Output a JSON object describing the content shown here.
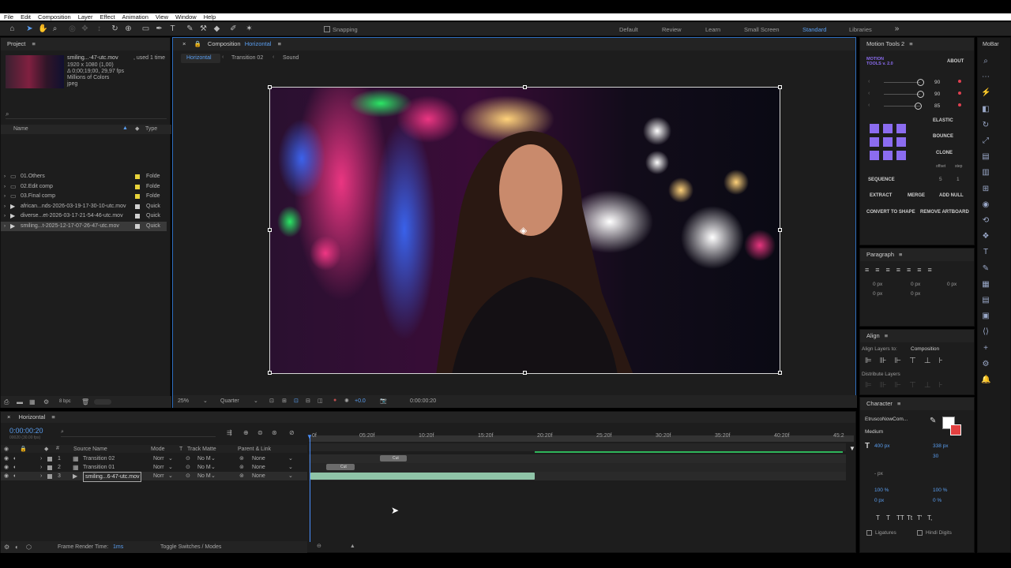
{
  "menu": [
    "File",
    "Edit",
    "Composition",
    "Layer",
    "Effect",
    "Animation",
    "View",
    "Window",
    "Help"
  ],
  "toolbar": {
    "snapping": "Snapping",
    "workspaces": [
      "Default",
      "Review",
      "Learn",
      "Small Screen",
      "Standard",
      "Libraries"
    ],
    "active_workspace": "Standard"
  },
  "project": {
    "title": "Project",
    "asset_name": "smiling...-47-utc.mov",
    "asset_used": ", used 1 time",
    "asset_info": [
      "1920 x 1080 (1,00)",
      "Δ 0;00;19;00, 29,97 fps",
      "Millions of Colors",
      "jpeg"
    ],
    "col_name": "Name",
    "col_type": "Type",
    "items": [
      {
        "name": "01.Others",
        "type": "Folde",
        "color": "#e8d33a",
        "kind": "folder"
      },
      {
        "name": "02.Edit comp",
        "type": "Folde",
        "color": "#e8d33a",
        "kind": "folder"
      },
      {
        "name": "03.Final comp",
        "type": "Folde",
        "color": "#e8d33a",
        "kind": "folder"
      },
      {
        "name": "african...nds-2026-03-19-17-30-10-utc.mov",
        "type": "Quick",
        "color": "#d0d0d0",
        "kind": "file"
      },
      {
        "name": "diverse...et-2026-03-17-21-54-46-utc.mov",
        "type": "Quick",
        "color": "#d0d0d0",
        "kind": "file"
      },
      {
        "name": "smiling...t-2025-12-17-07-26-47-utc.mov",
        "type": "Quick",
        "color": "#d0d0d0",
        "kind": "file"
      }
    ],
    "bpc": "8 bpc"
  },
  "composition": {
    "title": "Composition",
    "name": "Horizontal",
    "breadcrumbs": [
      "Horizontal",
      "Transition 02",
      "Sound"
    ],
    "zoom": "25%",
    "resolution": "Quarter",
    "exposure": "+0.0",
    "timecode": "0:00:00:20"
  },
  "timeline": {
    "tab": "Horizontal",
    "timecode": "0:00:00:20",
    "fps": "00020 (30.00 fps)",
    "headers": {
      "source": "Source Name",
      "mode": "Mode",
      "t": "T",
      "trackmatte": "Track Matte",
      "parent": "Parent & Link"
    },
    "ruler": [
      "0f",
      "05:20f",
      "10:20f",
      "15:20f",
      "20:20f",
      "25:20f",
      "30:20f",
      "35:20f",
      "40:20f",
      "45:2"
    ],
    "layers": [
      {
        "num": "1",
        "name": "Transition 02",
        "mode": "Norr",
        "matte": "No M",
        "parent": "None"
      },
      {
        "num": "2",
        "name": "Transition 01",
        "mode": "Norr",
        "matte": "No M",
        "parent": "None"
      },
      {
        "num": "3",
        "name": "smiling...6-47-utc.mov",
        "mode": "Norr",
        "matte": "No M",
        "parent": "None"
      }
    ],
    "clip_label": "Cut",
    "frame_render_label": "Frame Render Time:",
    "frame_render_value": "1ms",
    "toggle": "Toggle Switches / Modes"
  },
  "motion_tools": {
    "title": "Motion Tools 2",
    "brand": "MOTION TOOLS v. 2.0",
    "about": "ABOUT",
    "sliders": [
      "90",
      "90",
      "85"
    ],
    "labels": {
      "elastic": "ELASTIC",
      "bounce": "BOUNCE",
      "clone": "CLONE",
      "offset": "offset",
      "step": "step",
      "sequence": "SEQUENCE",
      "seq_a": "5",
      "seq_b": "1",
      "extract": "EXTRACT",
      "merge": "MERGE",
      "add_null": "ADD NULL",
      "convert": "CONVERT TO SHAPE",
      "remove": "REMOVE ARTBOARD"
    },
    "accent": "#8b6cf0"
  },
  "paragraph": {
    "title": "Paragraph",
    "px": "0 px"
  },
  "align": {
    "title": "Align",
    "align_to_label": "Align Layers to:",
    "align_to": "Composition",
    "distribute": "Distribute Layers"
  },
  "character": {
    "title": "Character",
    "font": "EtruscoNowCom...",
    "style": "Medium",
    "size": "400 px",
    "leading": "338 px",
    "tracking": "30",
    "px_unit": "- px",
    "scale_v": "100 %",
    "scale_h": "100 %",
    "baseline": "0 px",
    "tsume": "0 %",
    "ligatures": "Ligatures",
    "hindi": "Hindi Digits",
    "styles": [
      "T",
      "T",
      "TT",
      "Tt",
      "T'",
      "T,"
    ]
  },
  "mobar": "MoBar"
}
